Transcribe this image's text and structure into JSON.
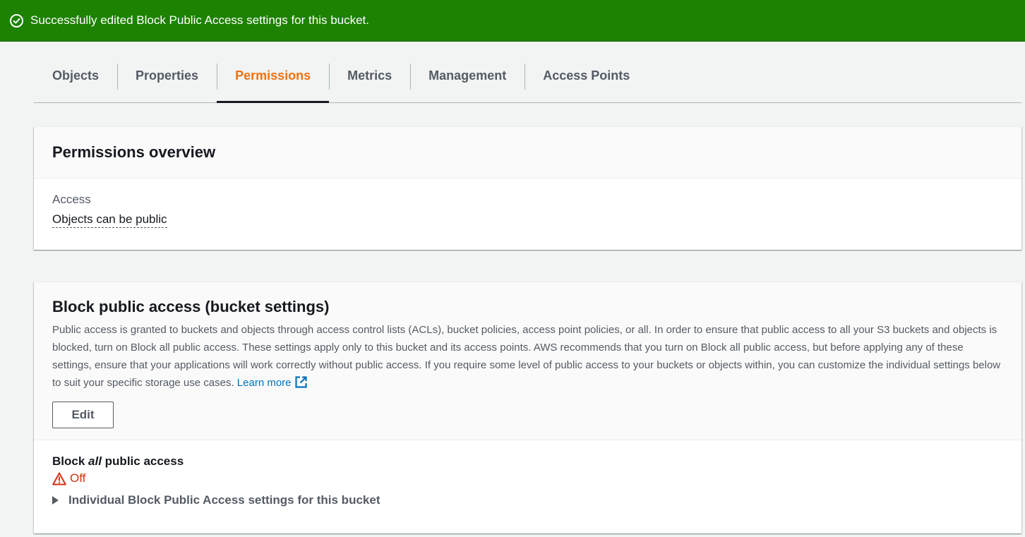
{
  "flash": {
    "message": "Successfully edited Block Public Access settings for this bucket.",
    "type": "success",
    "color": "#1d8102"
  },
  "tabs": [
    {
      "label": "Objects",
      "active": false
    },
    {
      "label": "Properties",
      "active": false
    },
    {
      "label": "Permissions",
      "active": true
    },
    {
      "label": "Metrics",
      "active": false
    },
    {
      "label": "Management",
      "active": false
    },
    {
      "label": "Access Points",
      "active": false
    }
  ],
  "overview": {
    "title": "Permissions overview",
    "access_label": "Access",
    "access_value": "Objects can be public"
  },
  "block_public_access": {
    "title": "Block public access (bucket settings)",
    "description": "Public access is granted to buckets and objects through access control lists (ACLs), bucket policies, access point policies, or all. In order to ensure that public access to all your S3 buckets and objects is blocked, turn on Block all public access. These settings apply only to this bucket and its access points. AWS recommends that you turn on Block all public access, but before applying any of these settings, ensure that your applications will work correctly without public access. If you require some level of public access to your buckets or objects within, you can customize the individual settings below to suit your specific storage use cases.",
    "learn_more": "Learn more",
    "edit_label": "Edit",
    "setting_prefix": "Block ",
    "setting_emphasis": "all",
    "setting_suffix": " public access",
    "status": "Off",
    "status_color": "#d13212",
    "expander_label": "Individual Block Public Access settings for this bucket"
  },
  "icons": {
    "flash": "check-circle-icon",
    "learn_more": "external-link-icon",
    "status": "warning-icon",
    "expander": "caret-right-icon"
  },
  "colors": {
    "active_tab": "#ec7211",
    "link": "#0073bb"
  }
}
